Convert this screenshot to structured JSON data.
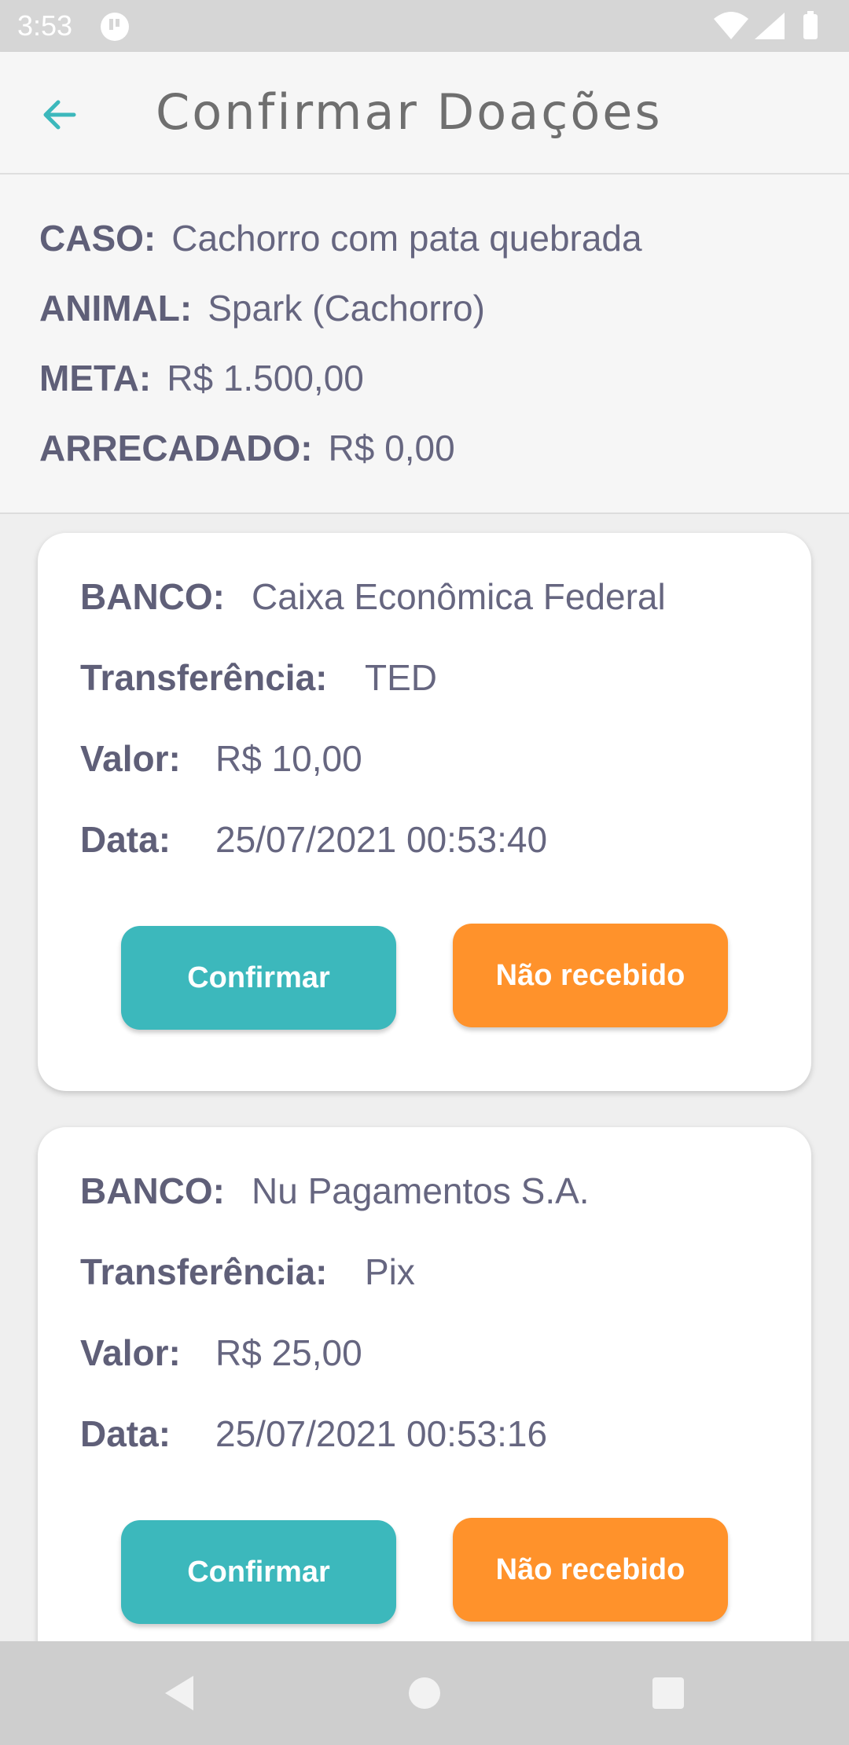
{
  "status_bar": {
    "time": "3:53"
  },
  "app_bar": {
    "title": "Confirmar Doações"
  },
  "case": {
    "caso_label": "CASO:",
    "caso_value": "Cachorro com pata quebrada",
    "animal_label": "ANIMAL:",
    "animal_value": "Spark (Cachorro)",
    "meta_label": "META:",
    "meta_value": "R$ 1.500,00",
    "arrecadado_label": "ARRECADADO:",
    "arrecadado_value": "R$ 0,00"
  },
  "donations": [
    {
      "banco_label": "BANCO:",
      "banco": "Caixa Econômica Federal",
      "transferencia_label": "Transferência:",
      "transferencia": "TED",
      "valor_label": "Valor:",
      "valor": "R$ 10,00",
      "data_label": "Data:",
      "data": "25/07/2021 00:53:40",
      "confirm_label": "Confirmar",
      "reject_label": "Não recebido"
    },
    {
      "banco_label": "BANCO:",
      "banco": "Nu Pagamentos S.A.",
      "transferencia_label": "Transferência:",
      "transferencia": "Pix",
      "valor_label": "Valor:",
      "valor": "R$ 25,00",
      "data_label": "Data:",
      "data": "25/07/2021 00:53:16",
      "confirm_label": "Confirmar",
      "reject_label": "Não recebido"
    }
  ],
  "colors": {
    "accent": "#3cb8bc",
    "warning": "#ff922b",
    "label": "#5f5f78"
  }
}
